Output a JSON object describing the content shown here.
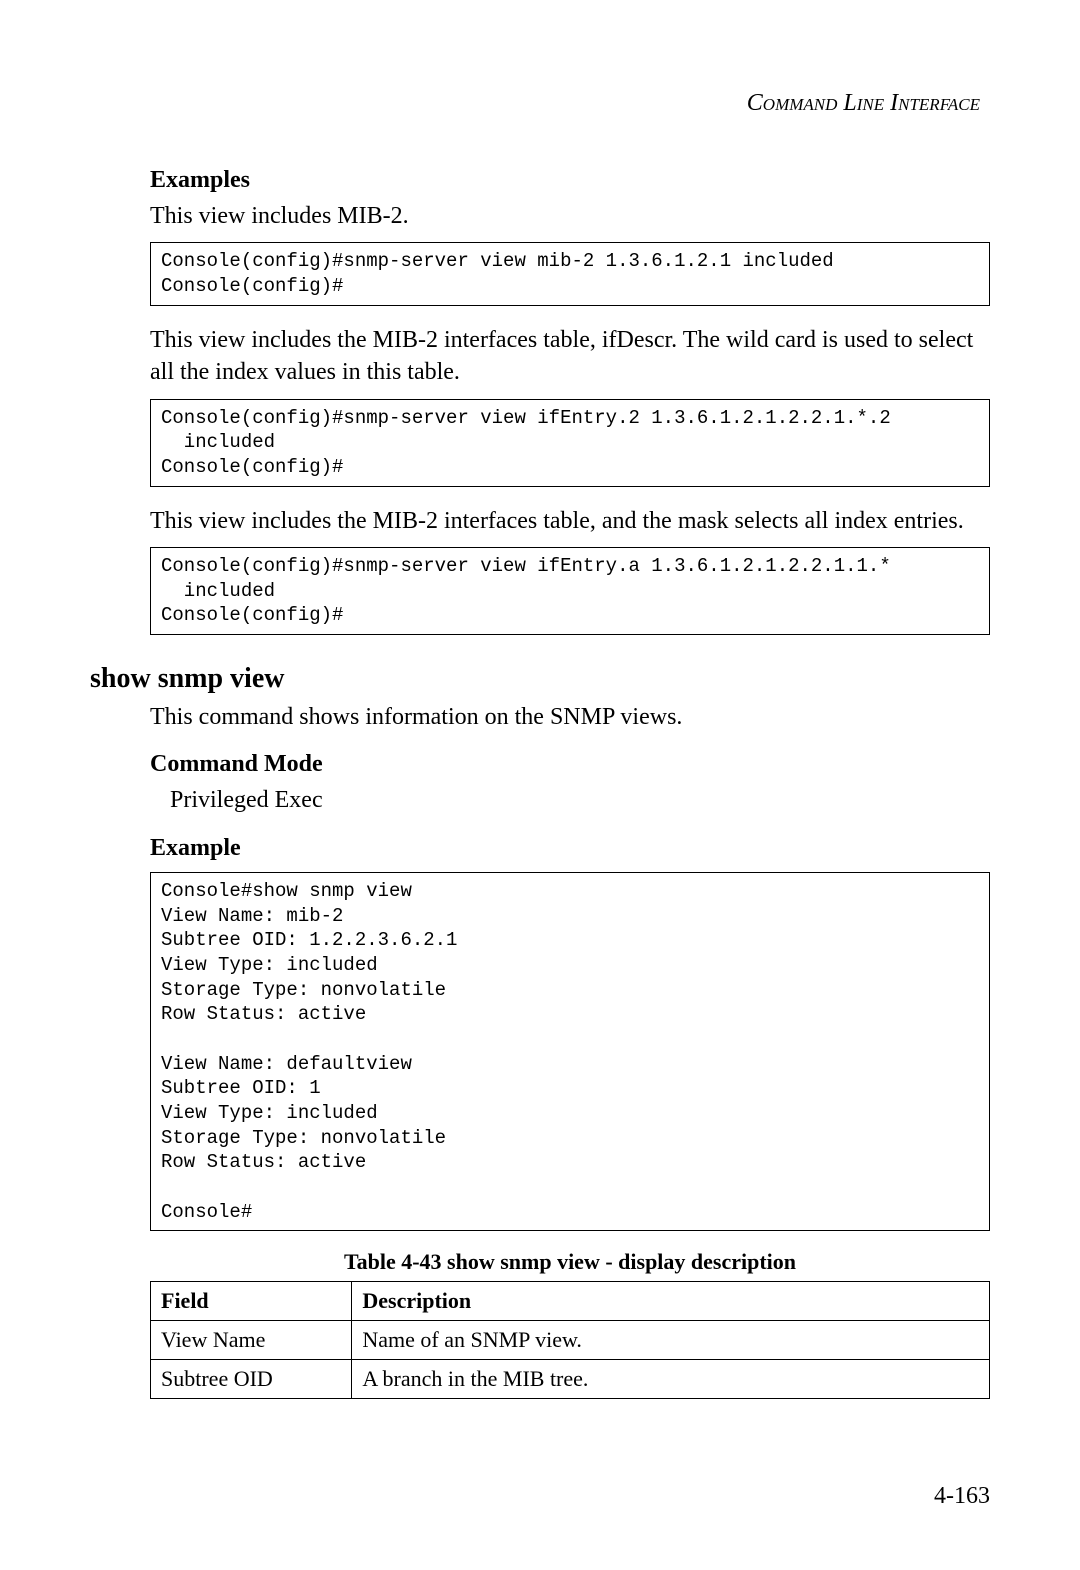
{
  "header": {
    "text": "Command Line Interface"
  },
  "examples": {
    "heading": "Examples",
    "intro1": "This view includes MIB-2.",
    "code1": "Console(config)#snmp-server view mib-2 1.3.6.1.2.1 included\nConsole(config)#",
    "intro2": "This view includes the MIB-2 interfaces table, ifDescr. The wild card is used to select all the index values in this table.",
    "code2": "Console(config)#snmp-server view ifEntry.2 1.3.6.1.2.1.2.2.1.*.2 \n  included\nConsole(config)#",
    "intro3": "This view includes the MIB-2 interfaces table, and the mask selects all index entries.",
    "code3": "Console(config)#snmp-server view ifEntry.a 1.3.6.1.2.1.2.2.1.1.* \n  included\nConsole(config)#"
  },
  "show_snmp_view": {
    "heading": "show snmp view",
    "description": "This command shows information on the SNMP views.",
    "command_mode_heading": "Command Mode",
    "command_mode_value": "Privileged Exec",
    "example_heading": "Example",
    "example_code": "Console#show snmp view\nView Name: mib-2\nSubtree OID: 1.2.2.3.6.2.1\nView Type: included\nStorage Type: nonvolatile\nRow Status: active\n\nView Name: defaultview\nSubtree OID: 1\nView Type: included\nStorage Type: nonvolatile\nRow Status: active\n\nConsole#"
  },
  "table": {
    "caption": "Table 4-43   show snmp view - display description",
    "headers": {
      "field": "Field",
      "description": "Description"
    },
    "rows": [
      {
        "field": "View Name",
        "description": "Name of an SNMP view."
      },
      {
        "field": "Subtree OID",
        "description": "A branch in the MIB tree."
      }
    ]
  },
  "page_number": "4-163"
}
